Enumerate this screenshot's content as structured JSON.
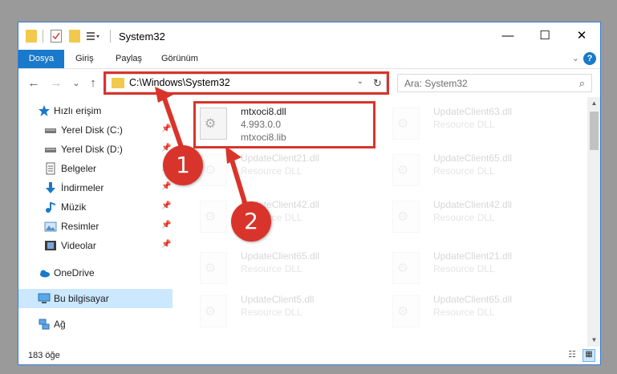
{
  "window": {
    "title": "System32",
    "minimize_glyph": "—",
    "maximize_glyph": "☐",
    "close_glyph": "✕"
  },
  "ribbon": {
    "tabs": [
      "Dosya",
      "Giriş",
      "Paylaş",
      "Görünüm"
    ],
    "expand_glyph": "⌄",
    "help_glyph": "?"
  },
  "nav": {
    "back_glyph": "←",
    "forward_glyph": "→",
    "recent_glyph": "⌄",
    "up_glyph": "↑",
    "address_path": "C:\\Windows\\System32",
    "address_dropdown_glyph": "⌄",
    "refresh_glyph": "↻",
    "search_placeholder": "Ara: System32",
    "search_glyph": "⌕"
  },
  "sidebar": {
    "items": [
      {
        "label": "Hızlı erişim",
        "icon": "star-icon"
      },
      {
        "label": "Yerel Disk (C:)",
        "icon": "drive-icon",
        "pinned": true
      },
      {
        "label": "Yerel Disk (D:)",
        "icon": "drive-icon",
        "pinned": true
      },
      {
        "label": "Belgeler",
        "icon": "documents-icon",
        "pinned": true
      },
      {
        "label": "İndirmeler",
        "icon": "downloads-icon",
        "pinned": true
      },
      {
        "label": "Müzik",
        "icon": "music-icon",
        "pinned": true
      },
      {
        "label": "Resimler",
        "icon": "pictures-icon",
        "pinned": true
      },
      {
        "label": "Videolar",
        "icon": "videos-icon",
        "pinned": true
      },
      {
        "label": "OneDrive",
        "icon": "cloud-icon"
      },
      {
        "label": "Bu bilgisayar",
        "icon": "computer-icon",
        "selected": true
      },
      {
        "label": "Ağ",
        "icon": "network-icon"
      }
    ],
    "pin_glyph": "📌"
  },
  "files": [
    {
      "name": "mtxoci8.dll",
      "version": "4.993.0.0",
      "desc": "mtxoci8.lib",
      "highlighted": true
    },
    {
      "name": "UpdateClient63.dll",
      "desc": "Resource DLL"
    },
    {
      "name": "UpdateClient21.dll",
      "desc": "Resource DLL"
    },
    {
      "name": "UpdateClient65.dll",
      "desc": "Resource DLL"
    },
    {
      "name": "UpdateClient42.dll",
      "desc": "Resource DLL"
    },
    {
      "name": "UpdateClient42.dll",
      "desc": "Resource DLL"
    },
    {
      "name": "UpdateClient65.dll",
      "desc": "Resource DLL"
    },
    {
      "name": "UpdateClient21.dll",
      "desc": "Resource DLL"
    },
    {
      "name": "UpdateClient5.dll",
      "desc": "Resource DLL"
    },
    {
      "name": "UpdateClient65.dll",
      "desc": "Resource DLL"
    }
  ],
  "status": {
    "item_count": "183 öğe",
    "details_view_glyph": "☷",
    "tiles_view_glyph": "▦"
  },
  "annotations": {
    "step1": "1",
    "step2": "2",
    "highlight_color": "#d9342b"
  },
  "colors": {
    "accent": "#1979ca",
    "selection": "#cce8ff"
  }
}
